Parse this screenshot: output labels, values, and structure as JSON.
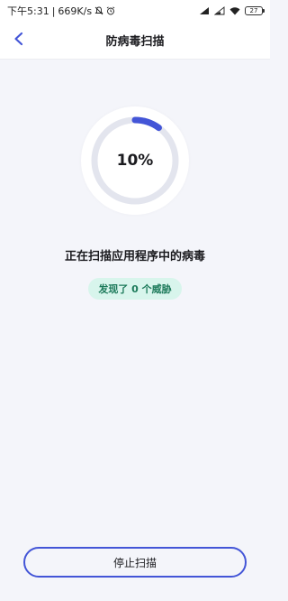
{
  "status_bar": {
    "time": "下午5:31",
    "separator": "|",
    "network_speed": "669K/s",
    "battery_level": "27",
    "icons": [
      "notification-muted-icon",
      "alarm-icon",
      "signal-icon",
      "signal-icon",
      "wifi-icon",
      "battery-icon"
    ]
  },
  "header": {
    "title": "防病毒扫描",
    "back_icon": "chevron-left-icon"
  },
  "scan": {
    "progress": 10,
    "progress_label": "10%",
    "status_text": "正在扫描应用程序中的病毒",
    "threats_text": "发现了 0 个威胁"
  },
  "actions": {
    "stop_label": "停止扫描"
  },
  "colors": {
    "accent": "#4355d7",
    "ring_track": "#e3e5ee",
    "badge_bg": "#d8f5ec",
    "badge_text": "#1c7a5a",
    "background": "#f4f5fa"
  }
}
